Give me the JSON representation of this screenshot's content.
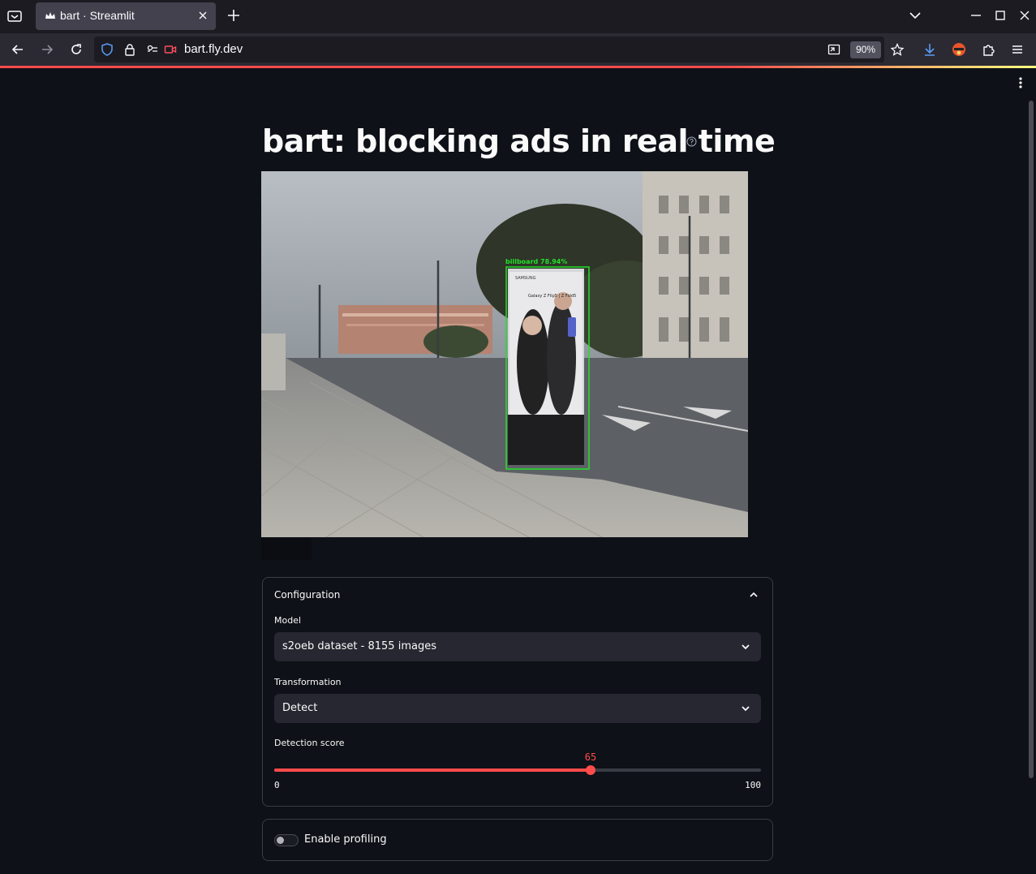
{
  "browser": {
    "tab_title": "bart · Streamlit",
    "url": "bart.fly.dev",
    "zoom": "90%"
  },
  "app": {
    "title": "bart: blocking ads in real time",
    "video": {
      "detection_label": "billboard 78.94%",
      "ad_brand": "SAMSUNG",
      "ad_text": "Galaxy Z Flip5 | Z Fold5"
    },
    "config": {
      "expander_title": "Configuration",
      "model": {
        "label": "Model",
        "value": "s2oeb dataset - 8155 images"
      },
      "transformation": {
        "label": "Transformation",
        "value": "Detect"
      },
      "detection_score": {
        "label": "Detection score",
        "value": "65",
        "min": "0",
        "max": "100",
        "fraction": 0.65
      }
    },
    "profiling": {
      "label": "Enable profiling",
      "enabled": false
    }
  },
  "colors": {
    "accent": "#ff4b4b",
    "background": "#0e1117",
    "detection_box": "#22e02a"
  }
}
